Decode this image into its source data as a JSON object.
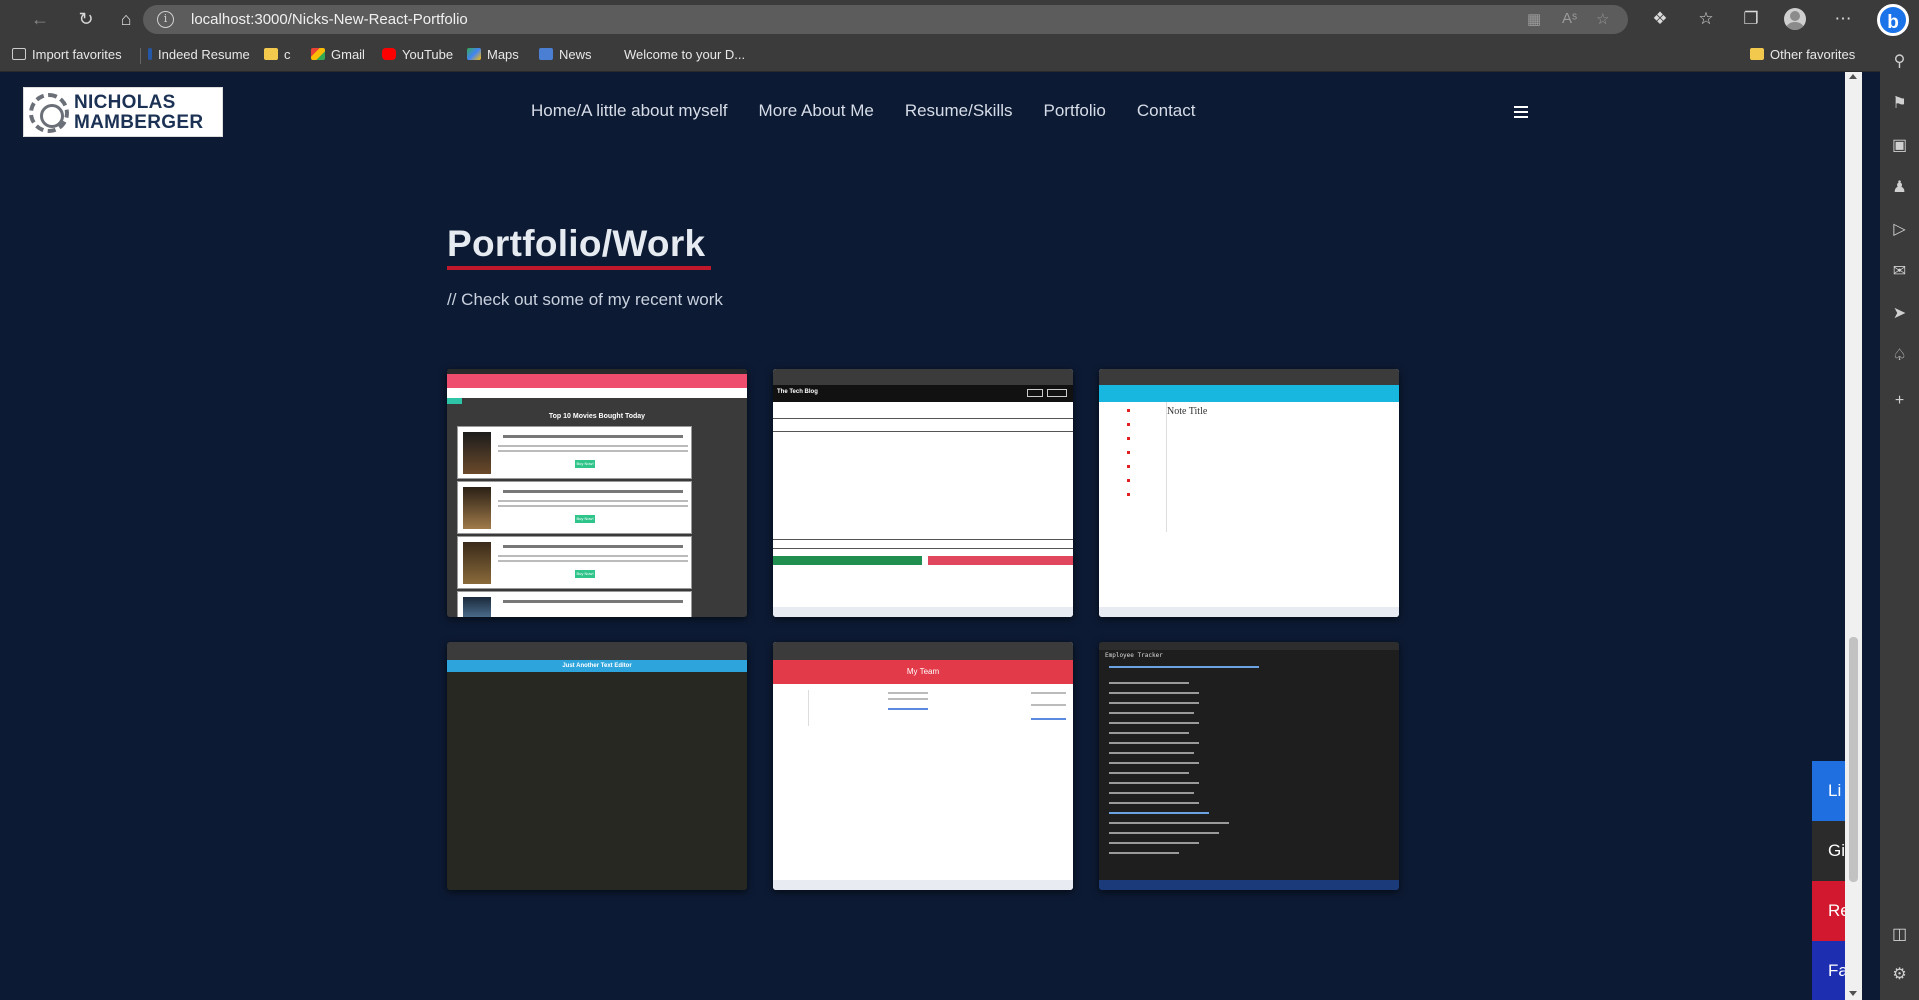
{
  "browser": {
    "url": "localhost:3000/Nicks-New-React-Portfolio",
    "bookmarks": [
      {
        "label": "Import favorites",
        "icon": "import-icon"
      },
      {
        "label": "Indeed Resume",
        "icon": "indeed-icon"
      },
      {
        "label": "c",
        "icon": "folder-icon"
      },
      {
        "label": "Gmail",
        "icon": "gmail-icon"
      },
      {
        "label": "YouTube",
        "icon": "youtube-icon"
      },
      {
        "label": "Maps",
        "icon": "maps-icon"
      },
      {
        "label": "News",
        "icon": "news-icon"
      },
      {
        "label": "Welcome to your D...",
        "icon": "page-icon"
      }
    ],
    "other_favorites": "Other favorites"
  },
  "site": {
    "logo_line1": "NICHOLAS",
    "logo_line2": "MAMBERGER",
    "nav": [
      "Home/A little about myself",
      "More About Me",
      "Resume/Skills",
      "Portfolio",
      "Contact"
    ]
  },
  "portfolio": {
    "title": "Portfolio/Work",
    "subtitle": "// Check out some of my recent work",
    "cards": [
      {
        "heading": "Top 10 Movies Bought Today",
        "button": "Buy Now!"
      },
      {
        "heading": "The Tech Blog"
      },
      {
        "heading": "Note Title"
      },
      {
        "heading": "Just Another Text Editor"
      },
      {
        "heading": "My Team"
      },
      {
        "heading": "Employee Tracker"
      }
    ]
  },
  "social": [
    {
      "label": "Li",
      "color": "#1f6fe0"
    },
    {
      "label": "Git",
      "color": "#2b2b2b"
    },
    {
      "label": "Re",
      "color": "#d1182e"
    },
    {
      "label": "Fa",
      "color": "#1d2fb0"
    }
  ]
}
